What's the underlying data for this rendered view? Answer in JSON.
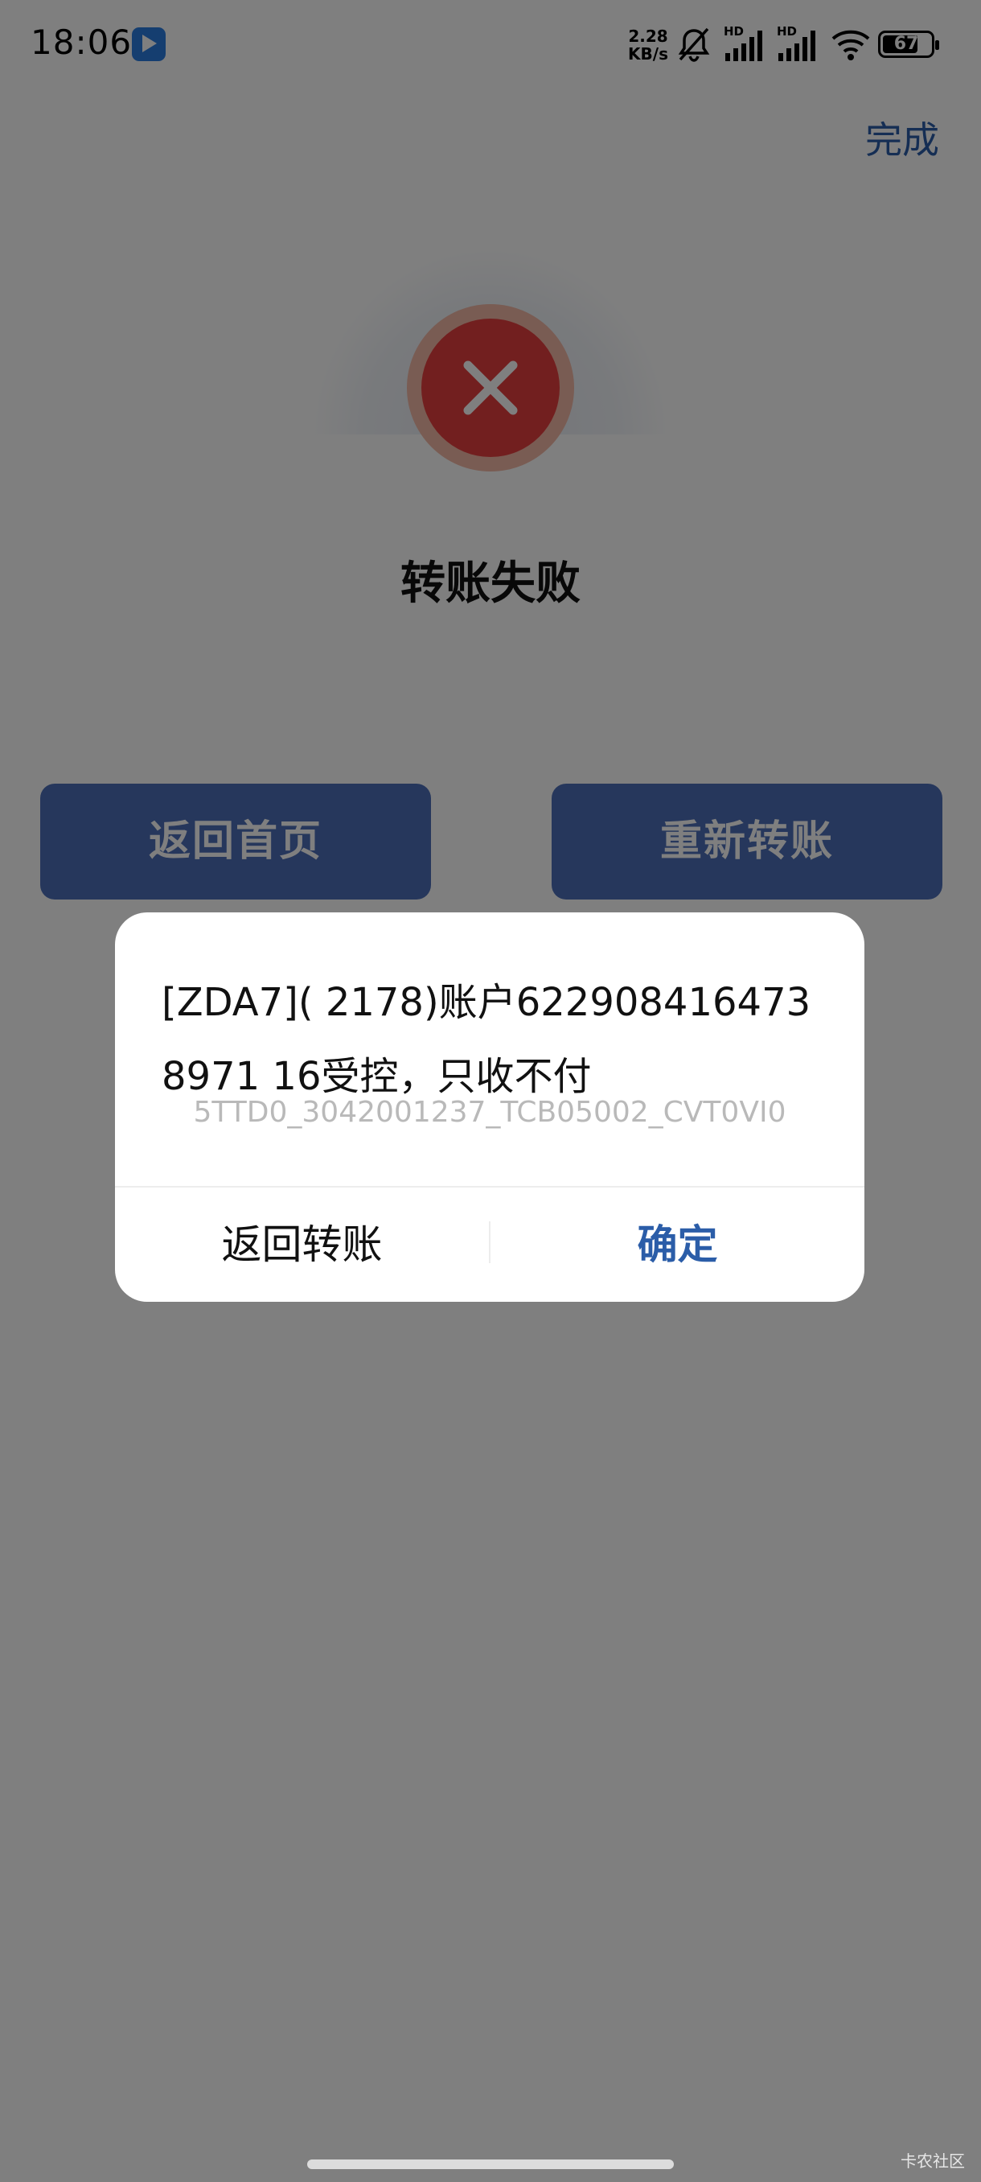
{
  "status_bar": {
    "time": "18:06",
    "net_speed_value": "2.28",
    "net_speed_unit": "KB/s",
    "signal_label_1": "HD",
    "signal_label_2": "HD",
    "battery_level": "67",
    "icons": [
      "app-badge-icon",
      "mute-bell-icon",
      "signal-icon",
      "signal-icon",
      "wifi-icon",
      "battery-icon"
    ]
  },
  "header": {
    "done_label": "完成"
  },
  "result": {
    "icon": "close-icon",
    "title": "转账失败"
  },
  "actions": {
    "home_label": "返回首页",
    "retry_label": "重新转账"
  },
  "dialog": {
    "message": "[ZDA7]( 2178)账户6229084164738971 16受控，只收不付",
    "code": "5TTD0_3042001237_TCB05002_CVT0VI0",
    "back_label": "返回转账",
    "confirm_label": "确定"
  },
  "watermark": "卡农社区",
  "colors": {
    "accent": "#2b5da8",
    "button": "#4d6fb8",
    "error": "#e53e3e",
    "overlay": "#000000"
  }
}
